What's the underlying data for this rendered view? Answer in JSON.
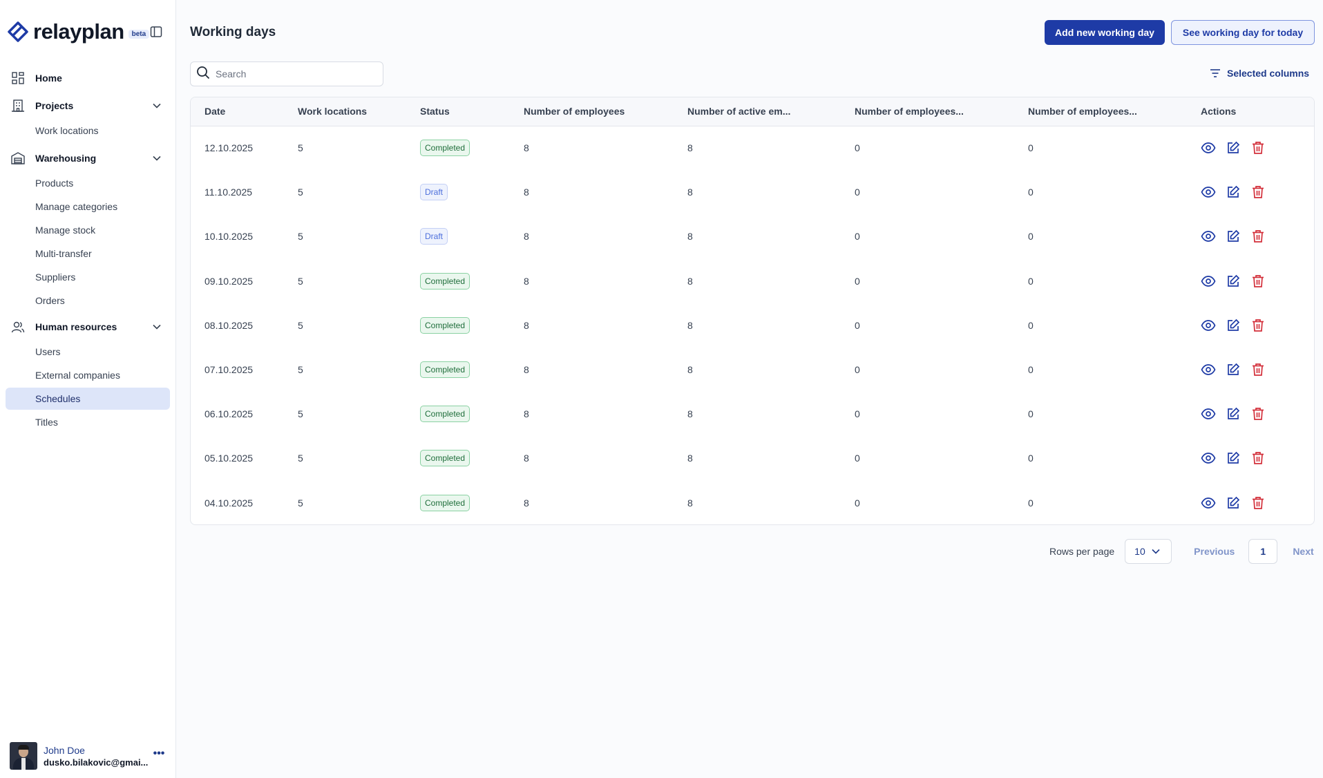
{
  "brand": {
    "name": "relayplan",
    "badge": "beta"
  },
  "sidebar": {
    "home": "Home",
    "projects": {
      "label": "Projects",
      "items": [
        "Work locations"
      ]
    },
    "warehousing": {
      "label": "Warehousing",
      "items": [
        "Products",
        "Manage categories",
        "Manage stock",
        "Multi-transfer",
        "Suppliers",
        "Orders"
      ]
    },
    "human_resources": {
      "label": "Human resources",
      "items": [
        "Users",
        "External companies",
        "Schedules",
        "Titles"
      ],
      "active": "Schedules"
    }
  },
  "user": {
    "name": "John Doe",
    "email": "dusko.bilakovic@gmai..."
  },
  "page": {
    "title": "Working days",
    "add_button": "Add new working day",
    "today_button": "See working day for today",
    "search_placeholder": "Search",
    "selected_columns": "Selected columns"
  },
  "table": {
    "columns": [
      "Date",
      "Work locations",
      "Status",
      "Number of employees",
      "Number of active em...",
      "Number of employees...",
      "Number of employees...",
      "Actions"
    ],
    "rows": [
      {
        "date": "12.10.2025",
        "locations": "5",
        "status": "Completed",
        "employees": "8",
        "active": "8",
        "col6": "0",
        "col7": "0"
      },
      {
        "date": "11.10.2025",
        "locations": "5",
        "status": "Draft",
        "employees": "8",
        "active": "8",
        "col6": "0",
        "col7": "0"
      },
      {
        "date": "10.10.2025",
        "locations": "5",
        "status": "Draft",
        "employees": "8",
        "active": "8",
        "col6": "0",
        "col7": "0"
      },
      {
        "date": "09.10.2025",
        "locations": "5",
        "status": "Completed",
        "employees": "8",
        "active": "8",
        "col6": "0",
        "col7": "0"
      },
      {
        "date": "08.10.2025",
        "locations": "5",
        "status": "Completed",
        "employees": "8",
        "active": "8",
        "col6": "0",
        "col7": "0"
      },
      {
        "date": "07.10.2025",
        "locations": "5",
        "status": "Completed",
        "employees": "8",
        "active": "8",
        "col6": "0",
        "col7": "0"
      },
      {
        "date": "06.10.2025",
        "locations": "5",
        "status": "Completed",
        "employees": "8",
        "active": "8",
        "col6": "0",
        "col7": "0"
      },
      {
        "date": "05.10.2025",
        "locations": "5",
        "status": "Completed",
        "employees": "8",
        "active": "8",
        "col6": "0",
        "col7": "0"
      },
      {
        "date": "04.10.2025",
        "locations": "5",
        "status": "Completed",
        "employees": "8",
        "active": "8",
        "col6": "0",
        "col7": "0"
      }
    ]
  },
  "pagination": {
    "rows_per_page_label": "Rows per page",
    "rows_per_page": "10",
    "previous": "Previous",
    "current_page": "1",
    "next": "Next"
  },
  "icons": {
    "view": "eye-icon",
    "edit": "edit-icon",
    "delete": "trash-icon"
  },
  "colors": {
    "primary": "#1e3ba6",
    "active_nav": "#dde5f9",
    "completed": "#1f6e3b",
    "draft": "#4d6fdc",
    "danger": "#d32f3a"
  }
}
